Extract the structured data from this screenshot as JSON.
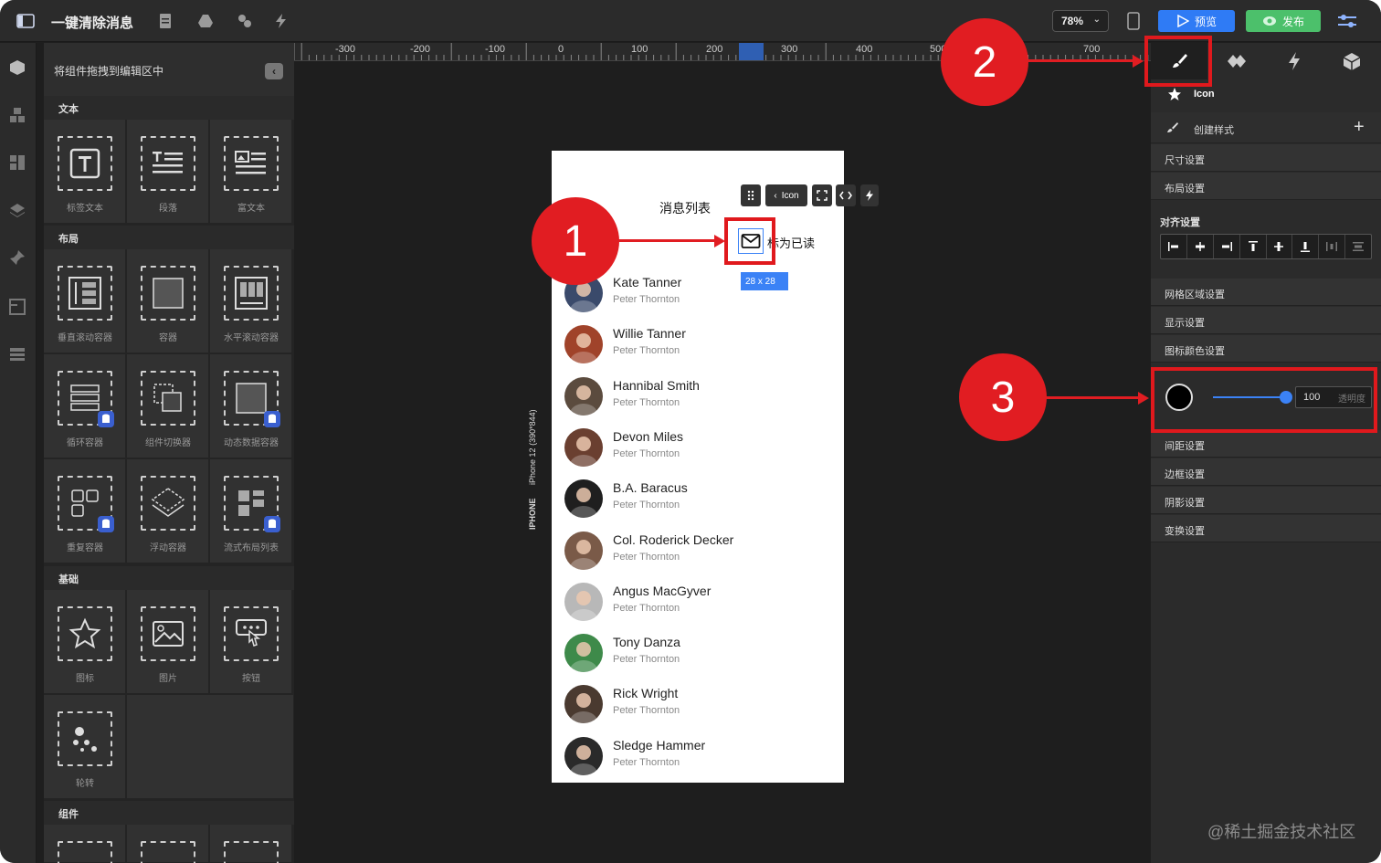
{
  "topbar": {
    "title": "一键清除消息",
    "zoom": "78%",
    "preview": "预览",
    "publish": "发布"
  },
  "component_panel": {
    "hint": "将组件拖拽到编辑区中",
    "sections": {
      "text": "文本",
      "layout": "布局",
      "basic": "基础",
      "components": "组件"
    },
    "items": {
      "label_text": "标签文本",
      "paragraph": "段落",
      "rich_text": "富文本",
      "v_scroll": "垂直滚动容器",
      "container": "容器",
      "h_scroll": "水平滚动容器",
      "loop": "循环容器",
      "switcher": "组件切换器",
      "dynamic": "动态数据容器",
      "repeat": "重复容器",
      "float": "浮动容器",
      "flow": "流式布局列表",
      "icon": "图标",
      "image": "图片",
      "button": "按钮",
      "carousel": "轮转"
    }
  },
  "ruler": [
    "-300",
    "-200",
    "-100",
    "0",
    "100",
    "200",
    "300",
    "400",
    "500",
    "700"
  ],
  "canvas": {
    "device_model": "iPhone 12 (390*844)",
    "device_type": "IPHONE",
    "page_title": "消息列表",
    "mark_read": "标为已读",
    "size_tag": "28 x 28",
    "float_toolbar_label": "Icon",
    "messages": [
      {
        "name": "Kate Tanner",
        "sub": "Peter Thornton",
        "color": "#3a4a6b"
      },
      {
        "name": "Willie Tanner",
        "sub": "Peter Thornton",
        "color": "#a0432a"
      },
      {
        "name": "Hannibal Smith",
        "sub": "Peter Thornton",
        "color": "#5b4b3e"
      },
      {
        "name": "Devon Miles",
        "sub": "Peter Thornton",
        "color": "#6a3f30"
      },
      {
        "name": "B.A. Baracus",
        "sub": "Peter Thornton",
        "color": "#1f1f1f"
      },
      {
        "name": "Col. Roderick Decker",
        "sub": "Peter Thornton",
        "color": "#7a5a48"
      },
      {
        "name": "Angus MacGyver",
        "sub": "Peter Thornton",
        "color": "#b8b8b8"
      },
      {
        "name": "Tony Danza",
        "sub": "Peter Thornton",
        "color": "#3e8a4a"
      },
      {
        "name": "Rick Wright",
        "sub": "Peter Thornton",
        "color": "#4a3a30"
      },
      {
        "name": "Sledge Hammer",
        "sub": "Peter Thornton",
        "color": "#2a2a2a"
      }
    ]
  },
  "callouts": [
    "1",
    "2",
    "3"
  ],
  "right_panel": {
    "component_name": "Icon",
    "create_style": "创建样式",
    "size": "尺寸设置",
    "layout": "布局设置",
    "align": "对齐设置",
    "grid": "网格区域设置",
    "display": "显示设置",
    "icon_color": "图标颜色设置",
    "opacity_value": "100",
    "opacity_label": "透明度",
    "spacing": "间距设置",
    "border": "边框设置",
    "shadow": "阴影设置",
    "transform": "变换设置"
  },
  "watermark": "@稀土掘金技术社区",
  "colors": {
    "accent": "#3b82f6",
    "callout": "#e11d22",
    "publish": "#4cc06b"
  }
}
